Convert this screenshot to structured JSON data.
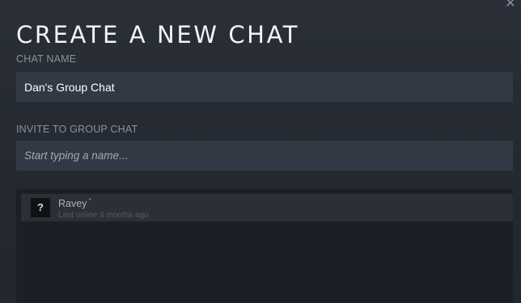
{
  "dialog": {
    "close_glyph": "✕",
    "title": "CREATE A NEW CHAT"
  },
  "chat_name": {
    "label": "CHAT NAME",
    "value": "Dan's Group Chat"
  },
  "invite": {
    "label": "INVITE TO GROUP CHAT",
    "placeholder": "Start typing a name..."
  },
  "friends": [
    {
      "name": "Ravey",
      "badge": "*",
      "status": "Last online 4 months ago",
      "avatar_glyph": "?"
    }
  ],
  "colors": {
    "background": "#262b33",
    "field": "#323844",
    "panel": "#1c1f25",
    "title": "#f2f4f7"
  }
}
